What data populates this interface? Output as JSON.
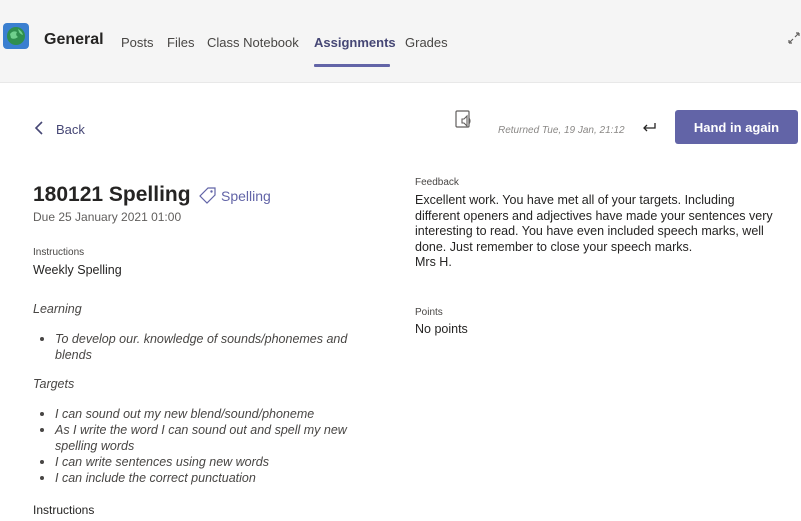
{
  "header": {
    "team_name": "General",
    "tabs": [
      {
        "label": "Posts"
      },
      {
        "label": "Files"
      },
      {
        "label": "Class Notebook"
      },
      {
        "label": "Assignments",
        "active": true
      },
      {
        "label": "Grades"
      }
    ],
    "accent_color": "#6264a7"
  },
  "toolbar": {
    "back_label": "Back",
    "returned_text": "Returned Tue, 19 Jan, 21:12",
    "hand_in_label": "Hand in again"
  },
  "assignment": {
    "title": "180121 Spelling",
    "category": "Spelling",
    "due": "Due 25 January 2021 01:00",
    "instructions_label": "Instructions",
    "instructions_text": "Weekly Spelling",
    "learning_heading": "Learning",
    "learning_items": [
      [
        "To develop our. knowledge of sounds/phonemes and",
        "blends"
      ]
    ],
    "targets_heading": "Targets",
    "target_items": [
      [
        "I can sound out my new blend/sound/phoneme"
      ],
      [
        "As I write the word I can sound out and spell my new",
        "spelling words"
      ],
      [
        "I can write sentences using new words"
      ],
      [
        "I can include the correct punctuation"
      ]
    ],
    "instructions_label_2": "Instructions"
  },
  "feedback": {
    "label": "Feedback",
    "lines": [
      "Excellent work.  You have met all of your targets.  Including",
      "different openers and adjectives have made your sentences very",
      "interesting to read.  You have even included speech marks, well",
      "done.  Just remember to close your speech marks.",
      "Mrs H."
    ],
    "points_label": "Points",
    "points_value": "No points"
  }
}
